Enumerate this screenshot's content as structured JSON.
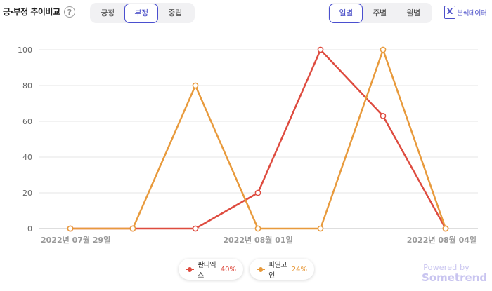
{
  "header": {
    "title": "긍·부정 추이비교",
    "help_icon": "?",
    "sentiment_tabs": [
      {
        "label": "긍정",
        "active": false
      },
      {
        "label": "부정",
        "active": true
      },
      {
        "label": "중립",
        "active": false
      }
    ],
    "period_tabs": [
      {
        "label": "일별",
        "active": true
      },
      {
        "label": "주별",
        "active": false
      },
      {
        "label": "월별",
        "active": false
      }
    ],
    "export": {
      "icon": "excel-icon",
      "icon_glyph": "X",
      "label": "분석데이터"
    }
  },
  "chart_data": {
    "type": "line",
    "x": [
      "2022-07-29",
      "2022-07-30",
      "2022-07-31",
      "2022-08-01",
      "2022-08-02",
      "2022-08-03",
      "2022-08-04"
    ],
    "xtick_labels": [
      "2022년 07월 29일",
      "2022년 08월 01일",
      "2022년 08월 04일"
    ],
    "xtick_index": [
      0,
      3,
      6
    ],
    "ylim": [
      0,
      100
    ],
    "yticks": [
      0,
      20,
      40,
      60,
      80,
      100
    ],
    "grid": true,
    "series": [
      {
        "name": "판디엑스",
        "color": "#de4b3f",
        "values": [
          0,
          0,
          0,
          20,
          100,
          63,
          0
        ]
      },
      {
        "name": "파일고인",
        "color": "#e89a3c",
        "values": [
          0,
          0,
          80,
          0,
          0,
          100,
          0
        ]
      }
    ]
  },
  "legend": [
    {
      "name": "판디엑스",
      "percent": "40%",
      "color": "#de4b3f"
    },
    {
      "name": "파일고인",
      "percent": "24%",
      "color": "#e89a3c"
    }
  ],
  "footer": {
    "powered_by": "Powered by",
    "brand": "Sometrend"
  }
}
